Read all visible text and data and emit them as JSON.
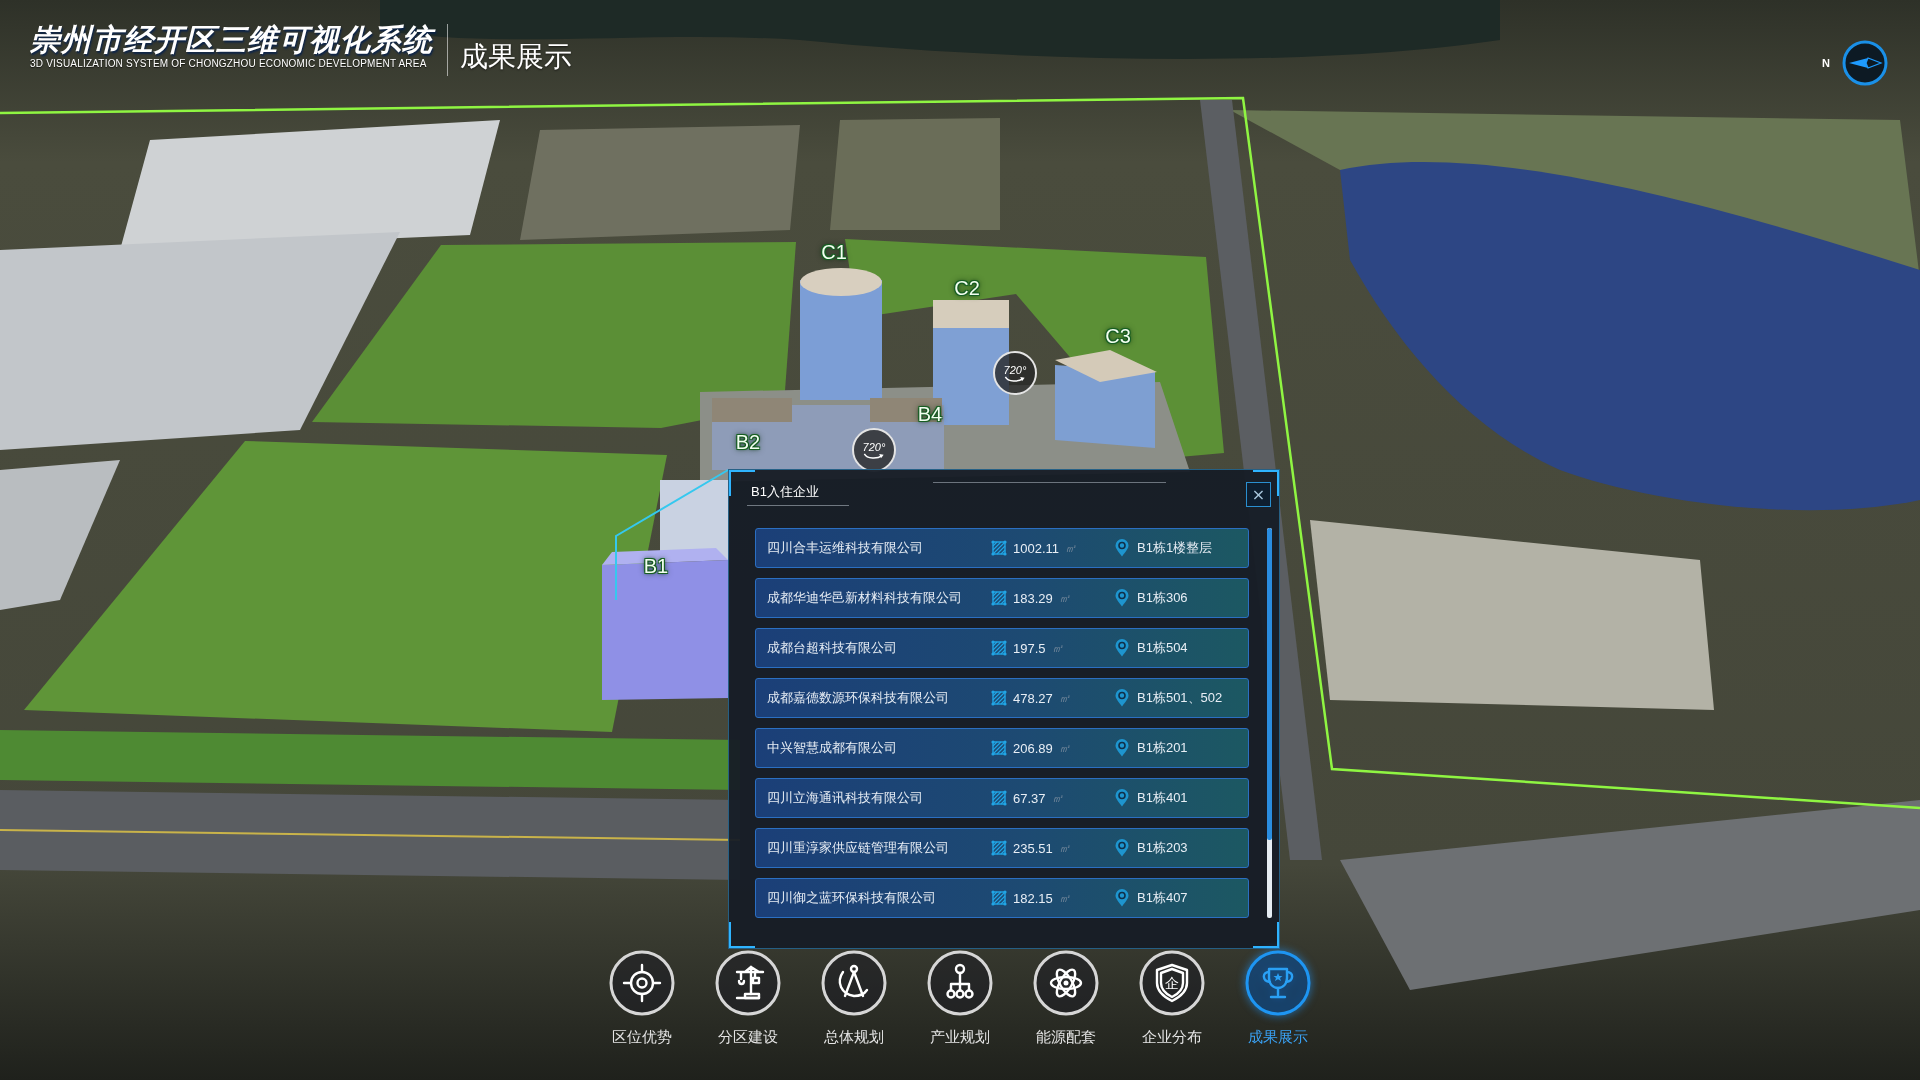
{
  "header": {
    "title": "崇州市经开区三维可视化系统",
    "subtitle": "3D VISUALIZATION SYSTEM OF CHONGZHOU ECONOMIC DEVELOPMENT AREA",
    "section": "成果展示"
  },
  "compass": {
    "label": "N"
  },
  "map": {
    "building_labels": [
      "C1",
      "C2",
      "C3",
      "B2",
      "B4",
      "B1"
    ],
    "panorama_markers": [
      "720°",
      "720°"
    ]
  },
  "popup": {
    "title": "B1入住企业",
    "close": "×",
    "companies": [
      {
        "name": "四川合丰运维科技有限公司",
        "area": "1002.11",
        "unit": "㎡",
        "location": "B1栋1楼整层"
      },
      {
        "name": "成都华迪华邑新材料科技有限公司",
        "area": "183.29",
        "unit": "㎡",
        "location": "B1栋306"
      },
      {
        "name": "成都台超科技有限公司",
        "area": "197.5",
        "unit": "㎡",
        "location": "B1栋504"
      },
      {
        "name": "成都嘉德数源环保科技有限公司",
        "area": "478.27",
        "unit": "㎡",
        "location": "B1栋501、502"
      },
      {
        "name": "中兴智慧成都有限公司",
        "area": "206.89",
        "unit": "㎡",
        "location": "B1栋201"
      },
      {
        "name": "四川立海通讯科技有限公司",
        "area": "67.37",
        "unit": "㎡",
        "location": "B1栋401"
      },
      {
        "name": "四川重淳家供应链管理有限公司",
        "area": "235.51",
        "unit": "㎡",
        "location": "B1栋203"
      },
      {
        "name": "四川御之蓝环保科技有限公司",
        "area": "182.15",
        "unit": "㎡",
        "location": "B1栋407"
      }
    ]
  },
  "nav": [
    {
      "label": "区位优势",
      "selected": false
    },
    {
      "label": "分区建设",
      "selected": false
    },
    {
      "label": "总体规划",
      "selected": false
    },
    {
      "label": "产业规划",
      "selected": false
    },
    {
      "label": "能源配套",
      "selected": false
    },
    {
      "label": "企业分布",
      "selected": false,
      "icon_text": "企"
    },
    {
      "label": "成果展示",
      "selected": true
    }
  ]
}
